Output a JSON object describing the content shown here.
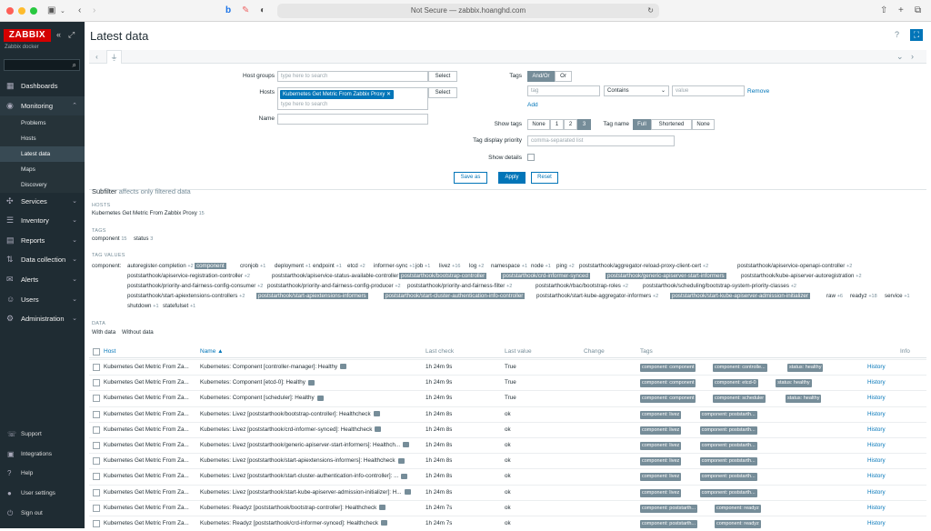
{
  "browser": {
    "address": "Not Secure — zabbix.hoanghd.com"
  },
  "sidebar": {
    "logo": "ZABBIX",
    "subtitle": "Zabbix docker",
    "nav": [
      {
        "label": "Dashboards",
        "icon": "dashboard-icon"
      },
      {
        "label": "Monitoring",
        "icon": "eye-icon"
      },
      {
        "label": "Services",
        "icon": "services-icon"
      },
      {
        "label": "Inventory",
        "icon": "list-icon"
      },
      {
        "label": "Reports",
        "icon": "report-icon"
      },
      {
        "label": "Data collection",
        "icon": "data-icon"
      },
      {
        "label": "Alerts",
        "icon": "bell-icon"
      },
      {
        "label": "Users",
        "icon": "users-icon"
      },
      {
        "label": "Administration",
        "icon": "gear-icon"
      }
    ],
    "monitoring_sub": [
      "Problems",
      "Hosts",
      "Latest data",
      "Maps",
      "Discovery"
    ],
    "bottom": [
      {
        "label": "Support",
        "icon": "support-icon"
      },
      {
        "label": "Integrations",
        "icon": "integrations-icon"
      },
      {
        "label": "Help",
        "icon": "help-icon"
      },
      {
        "label": "User settings",
        "icon": "user-icon"
      },
      {
        "label": "Sign out",
        "icon": "signout-icon"
      }
    ]
  },
  "header": {
    "title": "Latest data",
    "help": "?"
  },
  "filter": {
    "host_groups_label": "Host groups",
    "host_groups_placeholder": "type here to search",
    "select": "Select",
    "hosts_label": "Hosts",
    "host_chip": "Kubernetes Get Metric From Zabbix Proxy",
    "hosts_placeholder": "type here to search",
    "name_label": "Name",
    "tags_label": "Tags",
    "andor": "And/Or",
    "or": "Or",
    "tag_placeholder": "tag",
    "contains": "Contains",
    "value_placeholder": "value",
    "remove": "Remove",
    "add": "Add",
    "show_tags_label": "Show tags",
    "show_tags": [
      "None",
      "1",
      "2",
      "3"
    ],
    "tag_name_label": "Tag name",
    "tag_name": [
      "Full",
      "Shortened",
      "None"
    ],
    "priority_label": "Tag display priority",
    "priority_placeholder": "comma-separated list",
    "show_details_label": "Show details",
    "save_as": "Save as",
    "apply": "Apply",
    "reset": "Reset"
  },
  "subfilter": {
    "title": "Subfilter",
    "note": "affects only filtered data",
    "hosts_h": "HOSTS",
    "host": "Kubernetes Get Metric From Zabbix Proxy",
    "host_count": "15",
    "tags_h": "TAGS",
    "tags": [
      {
        "t": "component",
        "c": "15"
      },
      {
        "t": "status",
        "c": "3"
      }
    ],
    "tagvalues_h": "TAG VALUES",
    "tv_label": "component:",
    "tagvalues": [
      [
        {
          "t": "autoregister-completion",
          "c": "+2"
        },
        {
          "t": "component",
          "c": "",
          "hl": true
        },
        {
          "t": "cronjob",
          "c": "+1"
        },
        {
          "t": "deployment",
          "c": "+1"
        },
        {
          "t": "endpoint",
          "c": "+1"
        },
        {
          "t": "etcd",
          "c": "+2"
        },
        {
          "t": "informer-sync",
          "c": "+1"
        },
        {
          "t": "job",
          "c": "+1"
        },
        {
          "t": "livez",
          "c": "+16"
        },
        {
          "t": "log",
          "c": "+2"
        },
        {
          "t": "namespace",
          "c": "+1"
        },
        {
          "t": "node",
          "c": "+1"
        },
        {
          "t": "ping",
          "c": "+2"
        },
        {
          "t": "poststarthook/aggregator-reload-proxy-client-cert",
          "c": "+2"
        },
        {
          "t": "poststarthook/apiservice-openapi-controller",
          "c": "+2"
        }
      ],
      [
        {
          "t": "poststarthook/apiservice-registration-controller",
          "c": "+2"
        },
        {
          "t": "poststarthook/apiservice-status-available-controller",
          "c": "+2"
        },
        {
          "t": "poststarthook/bootstrap-controller",
          "c": "",
          "hl": true
        },
        {
          "t": "poststarthook/crd-informer-synced",
          "c": "",
          "hl": true
        },
        {
          "t": "poststarthook/generic-apiserver-start-informers",
          "c": "",
          "hl": true
        },
        {
          "t": "poststarthook/kube-apiserver-autoregistration",
          "c": "+2"
        }
      ],
      [
        {
          "t": "poststarthook/priority-and-fairness-config-consumer",
          "c": "+2"
        },
        {
          "t": "poststarthook/priority-and-fairness-config-producer",
          "c": "+2"
        },
        {
          "t": "poststarthook/priority-and-fairness-filter",
          "c": "+2"
        },
        {
          "t": "poststarthook/rbac/bootstrap-roles",
          "c": "+2"
        },
        {
          "t": "poststarthook/scheduling/bootstrap-system-priority-classes",
          "c": "+2"
        }
      ],
      [
        {
          "t": "poststarthook/start-apiextensions-controllers",
          "c": "+2"
        },
        {
          "t": "poststarthook/start-apiextensions-informers",
          "c": "",
          "hl": true
        },
        {
          "t": "poststarthook/start-cluster-authentication-info-controller",
          "c": "",
          "hl": true
        },
        {
          "t": "poststarthook/start-kube-aggregator-informers",
          "c": "+2"
        },
        {
          "t": "poststarthook/start-kube-apiserver-admission-initializer",
          "c": "",
          "hl": true
        },
        {
          "t": "raw",
          "c": "+6"
        },
        {
          "t": "readyz",
          "c": "+18"
        },
        {
          "t": "service",
          "c": "+1"
        }
      ],
      [
        {
          "t": "shutdown",
          "c": "+1"
        },
        {
          "t": "statefulset",
          "c": "+1"
        }
      ]
    ],
    "data_h": "DATA",
    "data": [
      "With data",
      "Without data"
    ]
  },
  "table": {
    "headers": {
      "host": "Host",
      "name": "Name ▲",
      "lastcheck": "Last check",
      "lastvalue": "Last value",
      "change": "Change",
      "tags": "Tags",
      "info": "Info"
    },
    "rows": [
      {
        "host": "Kubernetes Get Metric From Za...",
        "name": "Kubernetes: Component [controller-manager]: Healthy",
        "lc": "1h 24m 9s",
        "lv": "True",
        "tags": [
          "component: component",
          "component: controlle...",
          "status: healthy"
        ],
        "h": "History"
      },
      {
        "host": "Kubernetes Get Metric From Za...",
        "name": "Kubernetes: Component [etcd-0]: Healthy",
        "lc": "1h 24m 9s",
        "lv": "True",
        "tags": [
          "component: component",
          "component: etcd-0",
          "status: healthy"
        ],
        "h": "History"
      },
      {
        "host": "Kubernetes Get Metric From Za...",
        "name": "Kubernetes: Component [scheduler]: Healthy",
        "lc": "1h 24m 9s",
        "lv": "True",
        "tags": [
          "component: component",
          "component: scheduler",
          "status: healthy"
        ],
        "h": "History"
      },
      {
        "host": "Kubernetes Get Metric From Za...",
        "name": "Kubernetes: Livez [poststarthook/bootstrap-controller]: Healthcheck",
        "lc": "1h 24m 8s",
        "lv": "ok",
        "tags": [
          "component: livez",
          "component: poststarth..."
        ],
        "h": "History"
      },
      {
        "host": "Kubernetes Get Metric From Za...",
        "name": "Kubernetes: Livez [poststarthook/crd-informer-synced]: Healthcheck",
        "lc": "1h 24m 8s",
        "lv": "ok",
        "tags": [
          "component: livez",
          "component: poststarth..."
        ],
        "h": "History"
      },
      {
        "host": "Kubernetes Get Metric From Za...",
        "name": "Kubernetes: Livez [poststarthook/generic-apiserver-start-informers]: Healthch...",
        "lc": "1h 24m 8s",
        "lv": "ok",
        "tags": [
          "component: livez",
          "component: poststarth..."
        ],
        "h": "History"
      },
      {
        "host": "Kubernetes Get Metric From Za...",
        "name": "Kubernetes: Livez [poststarthook/start-apiextensions-informers]: Healthcheck",
        "lc": "1h 24m 8s",
        "lv": "ok",
        "tags": [
          "component: livez",
          "component: poststarth..."
        ],
        "h": "History"
      },
      {
        "host": "Kubernetes Get Metric From Za...",
        "name": "Kubernetes: Livez [poststarthook/start-cluster-authentication-info-controller]: ...",
        "lc": "1h 24m 8s",
        "lv": "ok",
        "tags": [
          "component: livez",
          "component: poststarth..."
        ],
        "h": "History"
      },
      {
        "host": "Kubernetes Get Metric From Za...",
        "name": "Kubernetes: Livez [poststarthook/start-kube-apiserver-admission-initializer]: H...",
        "lc": "1h 24m 8s",
        "lv": "ok",
        "tags": [
          "component: livez",
          "component: poststarth..."
        ],
        "h": "History"
      },
      {
        "host": "Kubernetes Get Metric From Za...",
        "name": "Kubernetes: Readyz [poststarthook/bootstrap-controller]: Healthcheck",
        "lc": "1h 24m 7s",
        "lv": "ok",
        "tags": [
          "component: poststarth...",
          "component: readyz"
        ],
        "h": "History"
      },
      {
        "host": "Kubernetes Get Metric From Za...",
        "name": "Kubernetes: Readyz [poststarthook/crd-informer-synced]: Healthcheck",
        "lc": "1h 24m 7s",
        "lv": "ok",
        "tags": [
          "component: poststarth...",
          "component: readyz"
        ],
        "h": "History"
      }
    ]
  }
}
